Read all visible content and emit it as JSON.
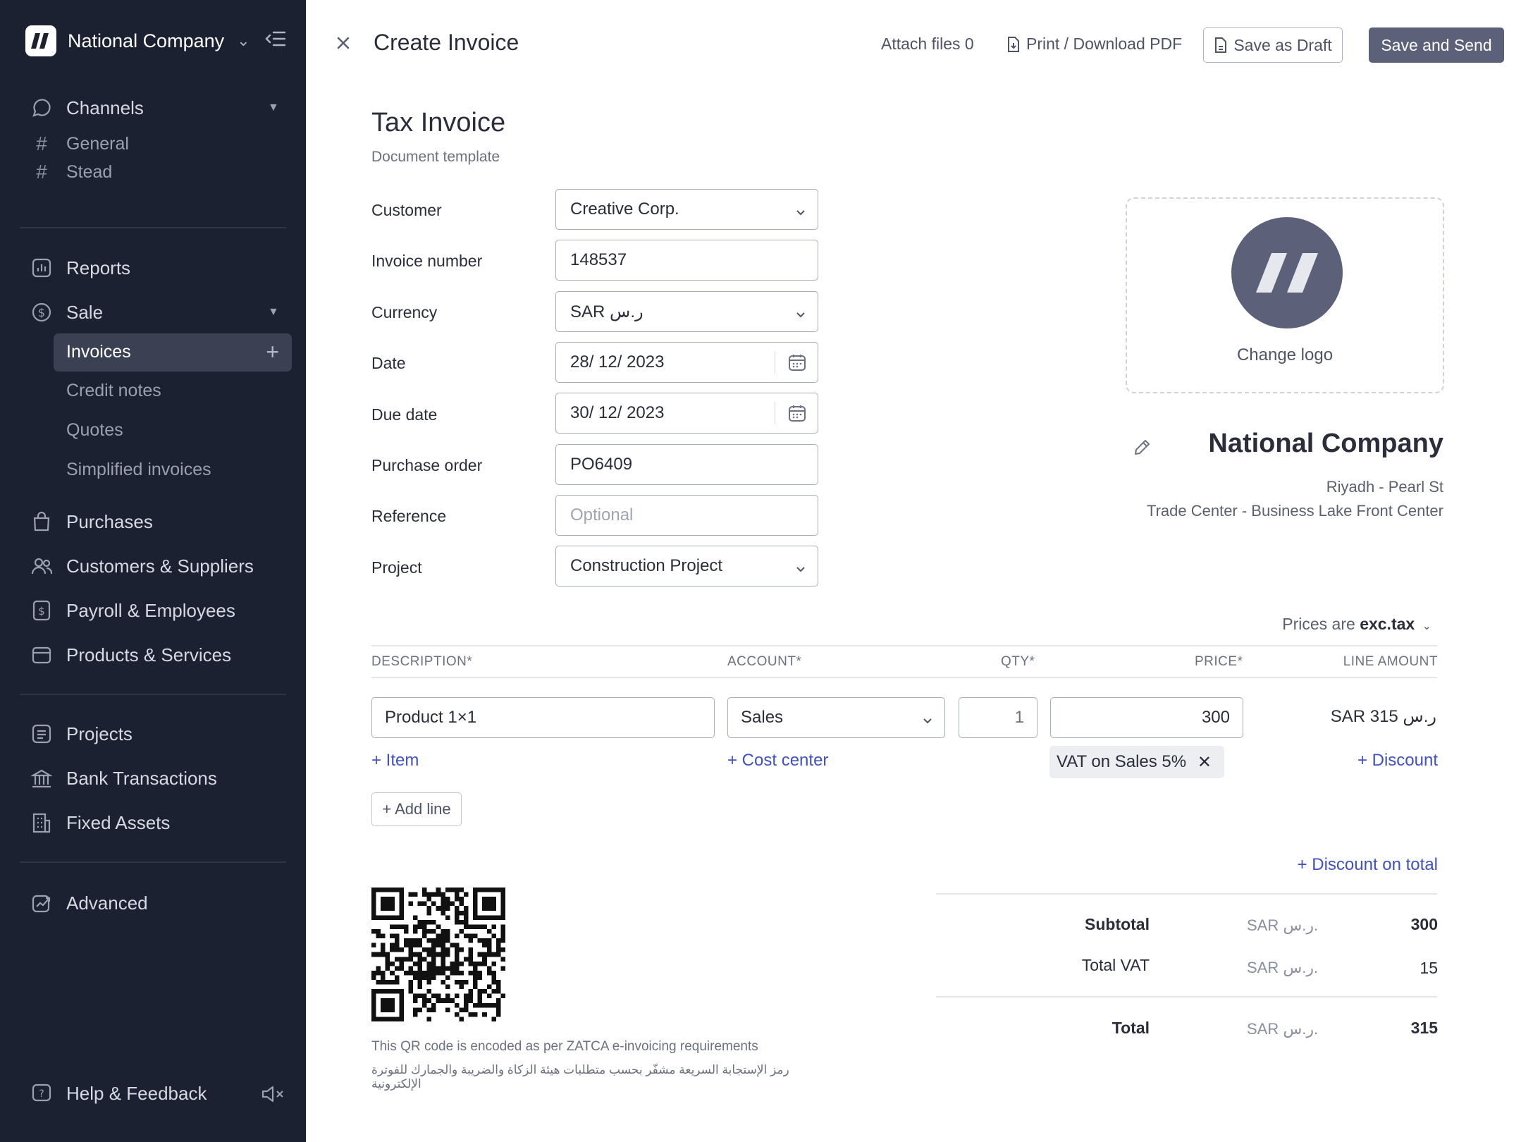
{
  "sidebar": {
    "org_name": "National Company",
    "channels": {
      "label": "Channels",
      "items": [
        "General",
        "Stead"
      ]
    },
    "reports": "Reports",
    "sale": {
      "label": "Sale",
      "items": [
        "Invoices",
        "Credit notes",
        "Quotes",
        "Simplified invoices"
      ]
    },
    "purchases": "Purchases",
    "customers": "Customers & Suppliers",
    "payroll": "Payroll & Employees",
    "products": "Products & Services",
    "projects": "Projects",
    "bank": "Bank Transactions",
    "fixed_assets": "Fixed Assets",
    "advanced": "Advanced",
    "help": "Help & Feedback"
  },
  "topbar": {
    "title": "Create Invoice",
    "attach": "Attach files 0",
    "print": "Print / Download PDF",
    "save_draft": "Save as Draft",
    "save_send": "Save and Send"
  },
  "form": {
    "doc_title": "Tax Invoice",
    "doc_subtitle": "Document template",
    "customer": {
      "label": "Customer",
      "value": "Creative Corp."
    },
    "invoice_number": {
      "label": "Invoice number",
      "value": "148537"
    },
    "currency": {
      "label": "Currency",
      "value": "SAR ر.س"
    },
    "date": {
      "label": "Date",
      "value": "28/ 12/ 2023"
    },
    "due_date": {
      "label": "Due date",
      "value": "30/ 12/ 2023"
    },
    "purchase_order": {
      "label": "Purchase order",
      "value": "PO6409"
    },
    "reference": {
      "label": "Reference",
      "placeholder": "Optional"
    },
    "project": {
      "label": "Project",
      "value": "Construction Project"
    }
  },
  "company": {
    "change_logo": "Change logo",
    "name": "National Company",
    "address1": "Riyadh - Pearl St",
    "address2": "Trade Center - Business Lake Front Center"
  },
  "prices": {
    "prefix": "Prices are",
    "mode": "exc.tax"
  },
  "table": {
    "headers": {
      "description": "DESCRIPTION*",
      "account": "ACCOUNT*",
      "qty": "QTY*",
      "price": "PRICE*",
      "line_amount": "LINE AMOUNT"
    },
    "row": {
      "description": "Product 1×1",
      "account": "Sales",
      "qty": "1",
      "price": "300",
      "line_amount": "SAR ر.س 315",
      "vat": "VAT on Sales 5%"
    },
    "add_item": "+ Item",
    "add_cost_center": "+ Cost center",
    "add_discount": "+ Discount",
    "add_line": "+ Add line"
  },
  "qr": {
    "note_en": "This QR code is encoded as per ZATCA e-invoicing requirements",
    "note_ar": "رمز الإستجابة السريعة مشفّر بحسب متطلبات هيئة الزكاة والضريبة والجمارك للفوترة الإلكترونية"
  },
  "totals": {
    "discount_on_total": "+ Discount on total",
    "subtotal": {
      "label": "Subtotal",
      "currency": "SAR ر.س.",
      "value": "300"
    },
    "vat": {
      "label": "Total VAT",
      "currency": "SAR ر.س.",
      "value": "15"
    },
    "total": {
      "label": "Total",
      "currency": "SAR ر.س.",
      "value": "315"
    }
  },
  "colors": {
    "sidebar_bg": "#1c2131",
    "primary": "#5c6079",
    "link": "#3f51c4"
  }
}
